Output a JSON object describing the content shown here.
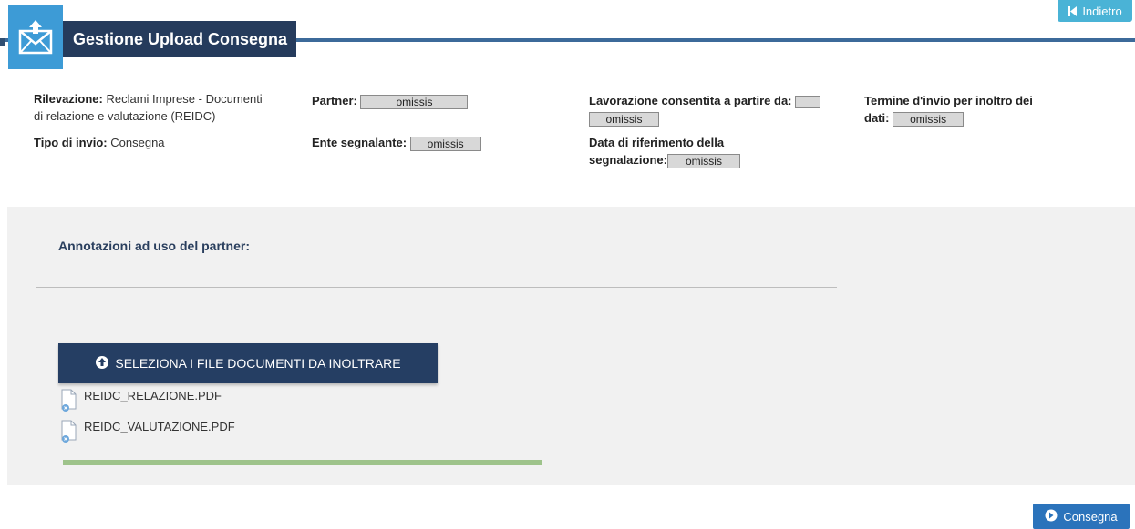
{
  "nav": {
    "back_label": "Indietro"
  },
  "header": {
    "title": "Gestione Upload Consegna"
  },
  "info": {
    "rilevazione_label": "Rilevazione:",
    "rilevazione_value_1": "Reclami Imprese - Documenti",
    "rilevazione_value_2": "di relazione e valutazione (REIDC)",
    "tipo_label": "Tipo di invio:",
    "tipo_value": "Consegna",
    "partner_label": "Partner:",
    "partner_value": "omissis",
    "ente_label": "Ente segnalante:",
    "ente_value": "omissis",
    "lavorazione_label": "Lavorazione consentita a partire da:",
    "lavorazione_value": "omissis",
    "data_rif_label_1": "Data di riferimento della",
    "data_rif_label_2": "segnalazione:",
    "data_rif_value": "omissis",
    "termine_label_1": "Termine d'invio per inoltro dei",
    "termine_label_2": "dati:",
    "termine_value": "omissis"
  },
  "annotations": {
    "title": "Annotazioni ad uso del partner:"
  },
  "upload": {
    "select_label": "SELEZIONA I FILE DOCUMENTI DA INOLTRARE",
    "files": [
      {
        "name": "REIDC_RELAZIONE.PDF"
      },
      {
        "name": "REIDC_VALUTAZIONE.PDF"
      }
    ],
    "progress": 1.0
  },
  "footer": {
    "consegna_label": "Consegna"
  },
  "colors": {
    "header_dark": "#253b5c",
    "header_icon": "#3d9bd6",
    "back_button": "#4ab3d6",
    "progress": "#9ec38b",
    "consegna": "#2b73bb"
  }
}
